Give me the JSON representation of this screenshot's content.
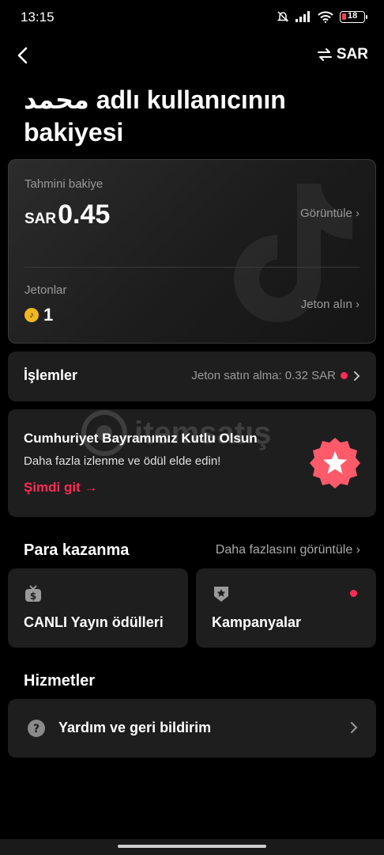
{
  "status_bar": {
    "time": "13:15",
    "battery": "18"
  },
  "header": {
    "currency_label": "SAR",
    "title": "محمد adlı kullanıcının bakiyesi"
  },
  "balance": {
    "estimated_label": "Tahmini bakiye",
    "currency": "SAR",
    "amount": "0.45",
    "view_link": "Görüntüle ›",
    "coins_label": "Jetonlar",
    "coins_value": "1",
    "get_coins_link": "Jeton alın ›"
  },
  "transactions": {
    "title": "İşlemler",
    "info": "Jeton satın alma: 0.32 SAR"
  },
  "promo": {
    "title": "Cumhuriyet Bayramımız Kutlu Olsun",
    "subtitle": "Daha fazla izlenme ve ödül elde edin!",
    "cta": "Şimdi git →"
  },
  "earn": {
    "title": "Para kazanma",
    "more": "Daha fazlasını görüntüle ›",
    "tiles": [
      {
        "label": "CANLI Yayın ödülleri"
      },
      {
        "label": "Kampanyalar"
      }
    ]
  },
  "services": {
    "title": "Hizmetler",
    "help_label": "Yardım ve geri bildirim"
  },
  "watermark": {
    "text": "itemsatış"
  },
  "colors": {
    "accent": "#fe2c55",
    "background": "#000000",
    "card": "#1e1e1e",
    "muted": "#9a9a9a"
  }
}
